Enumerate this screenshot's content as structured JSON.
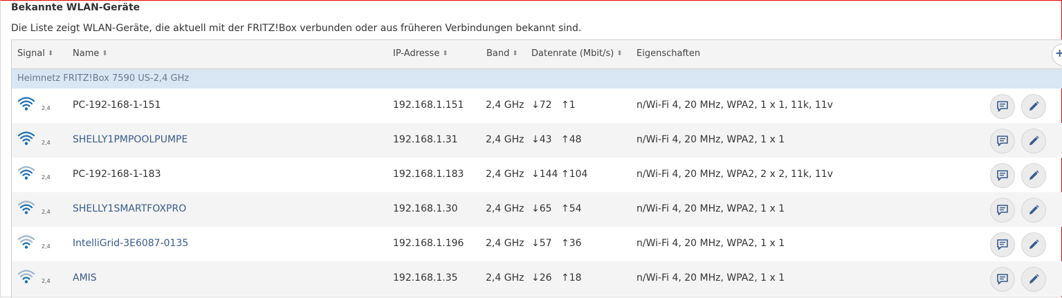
{
  "page": {
    "title": "Bekannte WLAN-Geräte",
    "description": "Die Liste zeigt WLAN-Geräte, die aktuell mit der FRITZ!Box verbunden oder aus früheren Verbindungen bekannt sind."
  },
  "table": {
    "headers": {
      "signal": "Signal",
      "name": "Name",
      "ip": "IP-Adresse",
      "band": "Band",
      "rate": "Datenrate (Mbit/s)",
      "props": "Eigenschaften"
    },
    "group_label": "Heimnetz FRITZ!Box 7590 US-2,4 GHz",
    "rows": [
      {
        "signal_band": "2,4",
        "signal_level": 4,
        "name": "PC-192-168-1-151",
        "name_is_link": false,
        "ip": "192.168.1.151",
        "band": "2,4 GHz",
        "rate_down": "↓72",
        "rate_up": "↑1",
        "props": "n/Wi-Fi 4, 20 MHz, WPA2, 1 x 1, 11k, 11v"
      },
      {
        "signal_band": "2,4",
        "signal_level": 4,
        "name": "SHELLY1PMPOOLPUMPE",
        "name_is_link": true,
        "ip": "192.168.1.31",
        "band": "2,4 GHz",
        "rate_down": "↓43",
        "rate_up": "↑48",
        "props": "n/Wi-Fi 4, 20 MHz, WPA2, 1 x 1"
      },
      {
        "signal_band": "2,4",
        "signal_level": 3,
        "name": "PC-192-168-1-183",
        "name_is_link": false,
        "ip": "192.168.1.183",
        "band": "2,4 GHz",
        "rate_down": "↓144",
        "rate_up": "↑104",
        "props": "n/Wi-Fi 4, 20 MHz, WPA2, 2 x 2, 11k, 11v"
      },
      {
        "signal_band": "2,4",
        "signal_level": 3,
        "name": "SHELLY1SMARTFOXPRO",
        "name_is_link": true,
        "ip": "192.168.1.30",
        "band": "2,4 GHz",
        "rate_down": "↓65",
        "rate_up": "↑54",
        "props": "n/Wi-Fi 4, 20 MHz, WPA2, 1 x 1"
      },
      {
        "signal_band": "2,4",
        "signal_level": 2,
        "name": "IntelliGrid-3E6087-0135",
        "name_is_link": true,
        "ip": "192.168.1.196",
        "band": "2,4 GHz",
        "rate_down": "↓57",
        "rate_up": "↑36",
        "props": "n/Wi-Fi 4, 20 MHz, WPA2, 1 x 1"
      },
      {
        "signal_band": "2,4",
        "signal_level": 2,
        "name": "AMIS",
        "name_is_link": true,
        "ip": "192.168.1.35",
        "band": "2,4 GHz",
        "rate_down": "↓26",
        "rate_up": "↑18",
        "props": "n/Wi-Fi 4, 20 MHz, WPA2, 1 x 1"
      }
    ]
  },
  "icons": {
    "signal": "wifi-signal-icon",
    "sort": "sort-icon",
    "add": "plus-icon",
    "details": "speech-bubble-icon",
    "edit": "pencil-icon"
  },
  "colors": {
    "wifi_strong": "#1a6fb5",
    "wifi_weak": "#9db3c8",
    "link": "#3a5b8c",
    "group_bg": "#d9e6f3"
  }
}
